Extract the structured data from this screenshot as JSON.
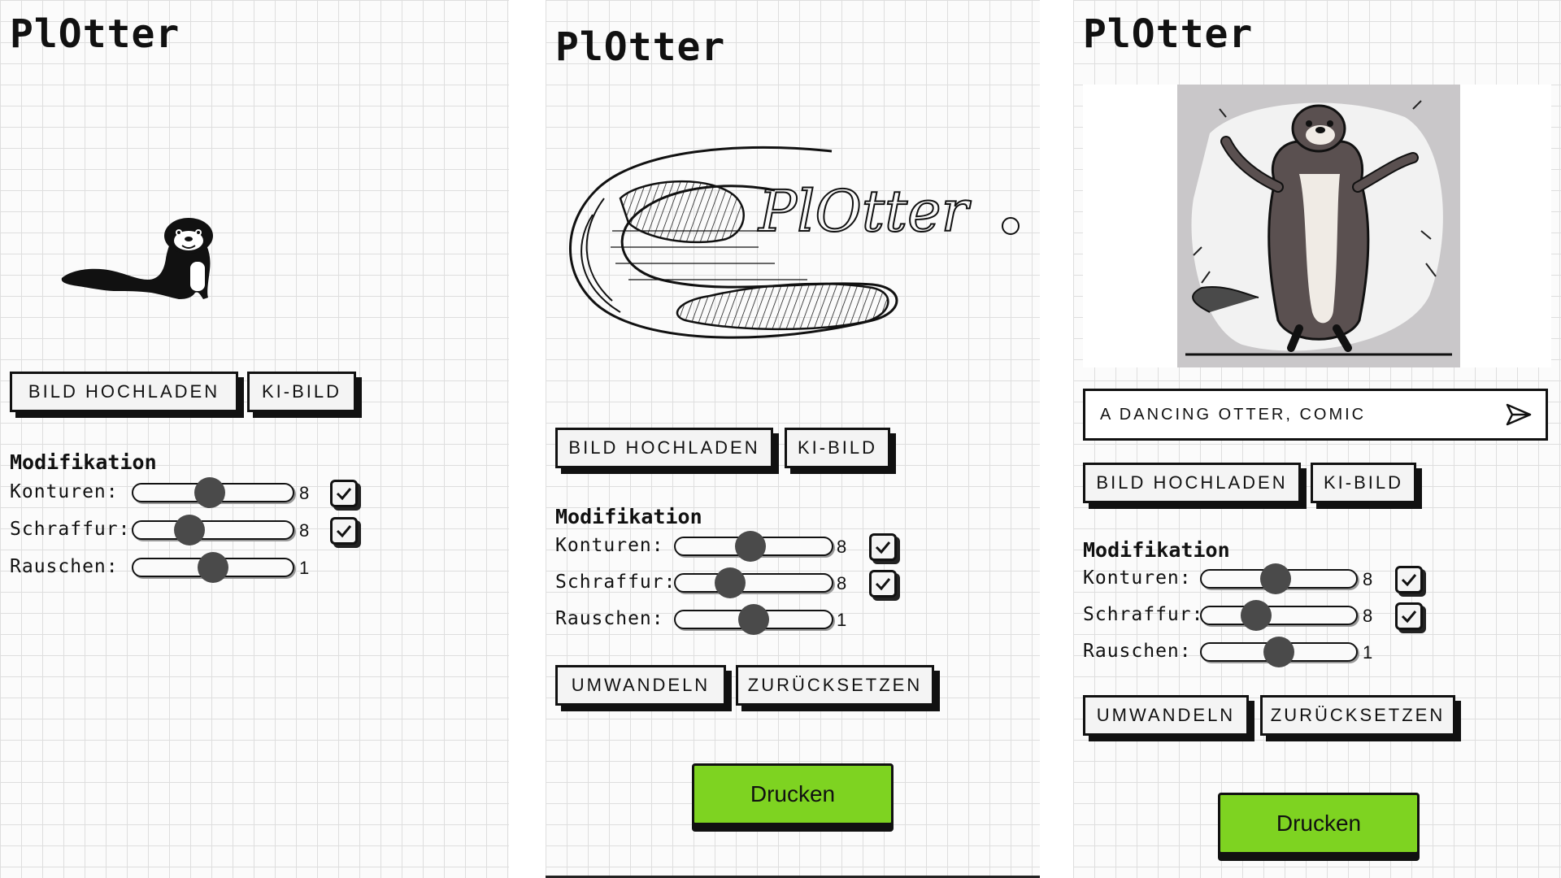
{
  "app": {
    "title": "PlOtter"
  },
  "buttons": {
    "upload": "BILD HOCHLADEN",
    "ai_image": "KI-BILD",
    "convert": "UMWANDELN",
    "reset": "ZURÜCKSETZEN",
    "print": "Drucken"
  },
  "modification": {
    "title": "Modifikation",
    "sliders": [
      {
        "label": "Konturen:",
        "value": "8",
        "checked": true
      },
      {
        "label": "Schraffur:",
        "value": "8",
        "checked": true
      },
      {
        "label": "Rauschen:",
        "value": "1"
      }
    ]
  },
  "screen1": {
    "slider_positions": [
      0.48,
      0.35,
      0.5
    ]
  },
  "screen2": {
    "logo_text": "PlOtter",
    "slider_positions": [
      0.48,
      0.35,
      0.5
    ]
  },
  "screen3": {
    "prompt_value": "A DANCING OTTER, COMIC",
    "slider_positions": [
      0.48,
      0.35,
      0.5
    ]
  },
  "colors": {
    "print_button": "#7ed321",
    "slider_thumb": "#4a4a4a",
    "grid_line": "#dedede"
  },
  "icons": [
    "otter-silhouette",
    "checkmark-icon",
    "send-icon",
    "dancing-otter-image",
    "plotter-logo-drawing"
  ]
}
